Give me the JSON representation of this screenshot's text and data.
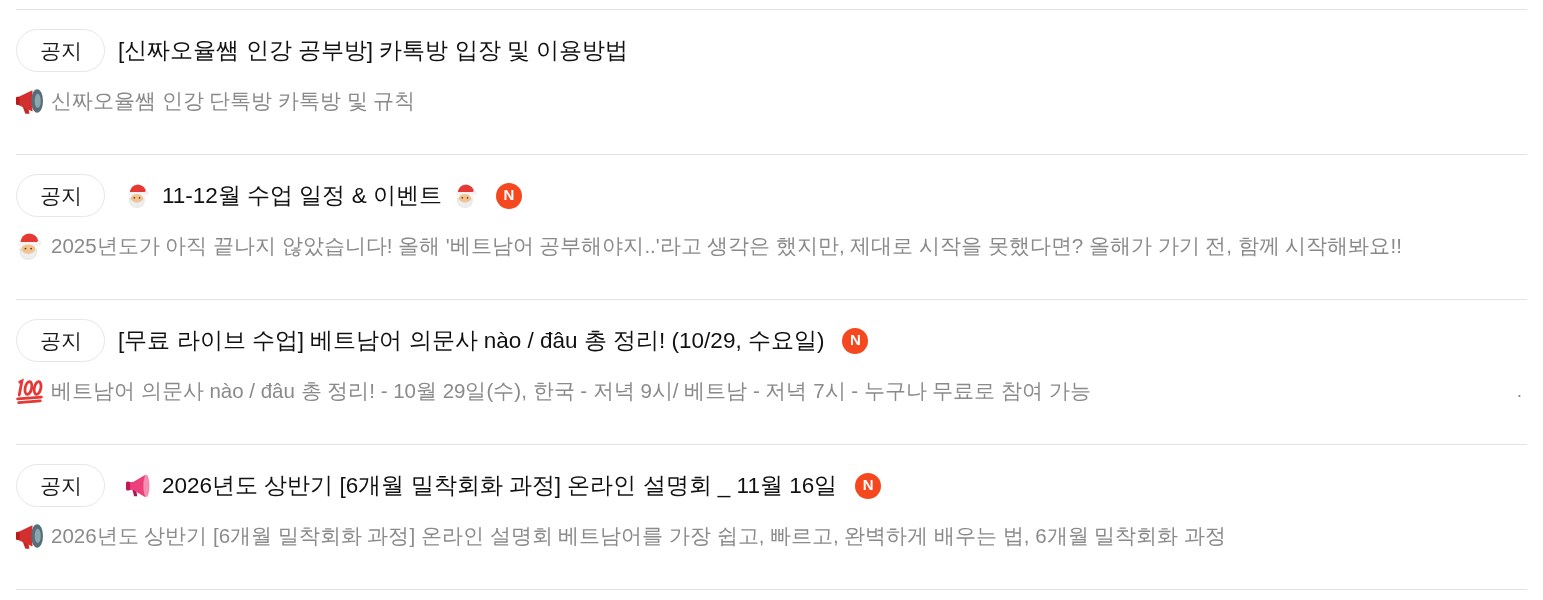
{
  "posts": [
    {
      "tag": "공지",
      "title": [
        {
          "kind": "text",
          "text": "[신짜오율쌤 인강 공부방] 카톡방 입장 및 이용방법"
        }
      ],
      "summary": [
        {
          "kind": "loudspeaker"
        },
        {
          "kind": "text",
          "text": "신짜오율쌤 인강 단톡방 카톡방 및 규칙"
        }
      ]
    },
    {
      "tag": "공지",
      "title": [
        {
          "kind": "santa"
        },
        {
          "kind": "text",
          "text": "11-12월 수업 일정 & 이벤트"
        },
        {
          "kind": "santa"
        }
      ],
      "badge": "N",
      "summary": [
        {
          "kind": "santa"
        },
        {
          "kind": "text",
          "text": "2025년도가 아직 끝나지 않았습니다! 올해 '베트남어 공부해야지..'라고 생각은 했지만, 제대로 시작을 못했다면? 올해가 가기 전, 함께 시작해봐요!!"
        }
      ]
    },
    {
      "tag": "공지",
      "title": [
        {
          "kind": "text",
          "text": "[무료 라이브 수업] 베트남어 의문사 nào / đâu 총 정리! (10/29, 수요일)"
        }
      ],
      "badge": "N",
      "summary": [
        {
          "kind": "hundred"
        },
        {
          "kind": "text",
          "text": "베트남어 의문사 nào / đâu 총 정리! - 10월 29일(수), 한국 - 저녁 9시/ 베트남 - 저녁 7시 - 누구나 무료로 참여 가능"
        }
      ],
      "trailing": "."
    },
    {
      "tag": "공지",
      "title": [
        {
          "kind": "megaphone"
        },
        {
          "kind": "text",
          "text": "2026년도 상반기 [6개월 밀착회화 과정] 온라인 설명회 _ 11월 16일"
        }
      ],
      "badge": "N",
      "summary": [
        {
          "kind": "loudspeaker"
        },
        {
          "kind": "text",
          "text": "2026년도 상반기 [6개월 밀착회화 과정] 온라인 설명회 베트남어를 가장 쉽고, 빠르고, 완벽하게 배우는 법, 6개월 밀착회화 과정"
        }
      ]
    }
  ]
}
